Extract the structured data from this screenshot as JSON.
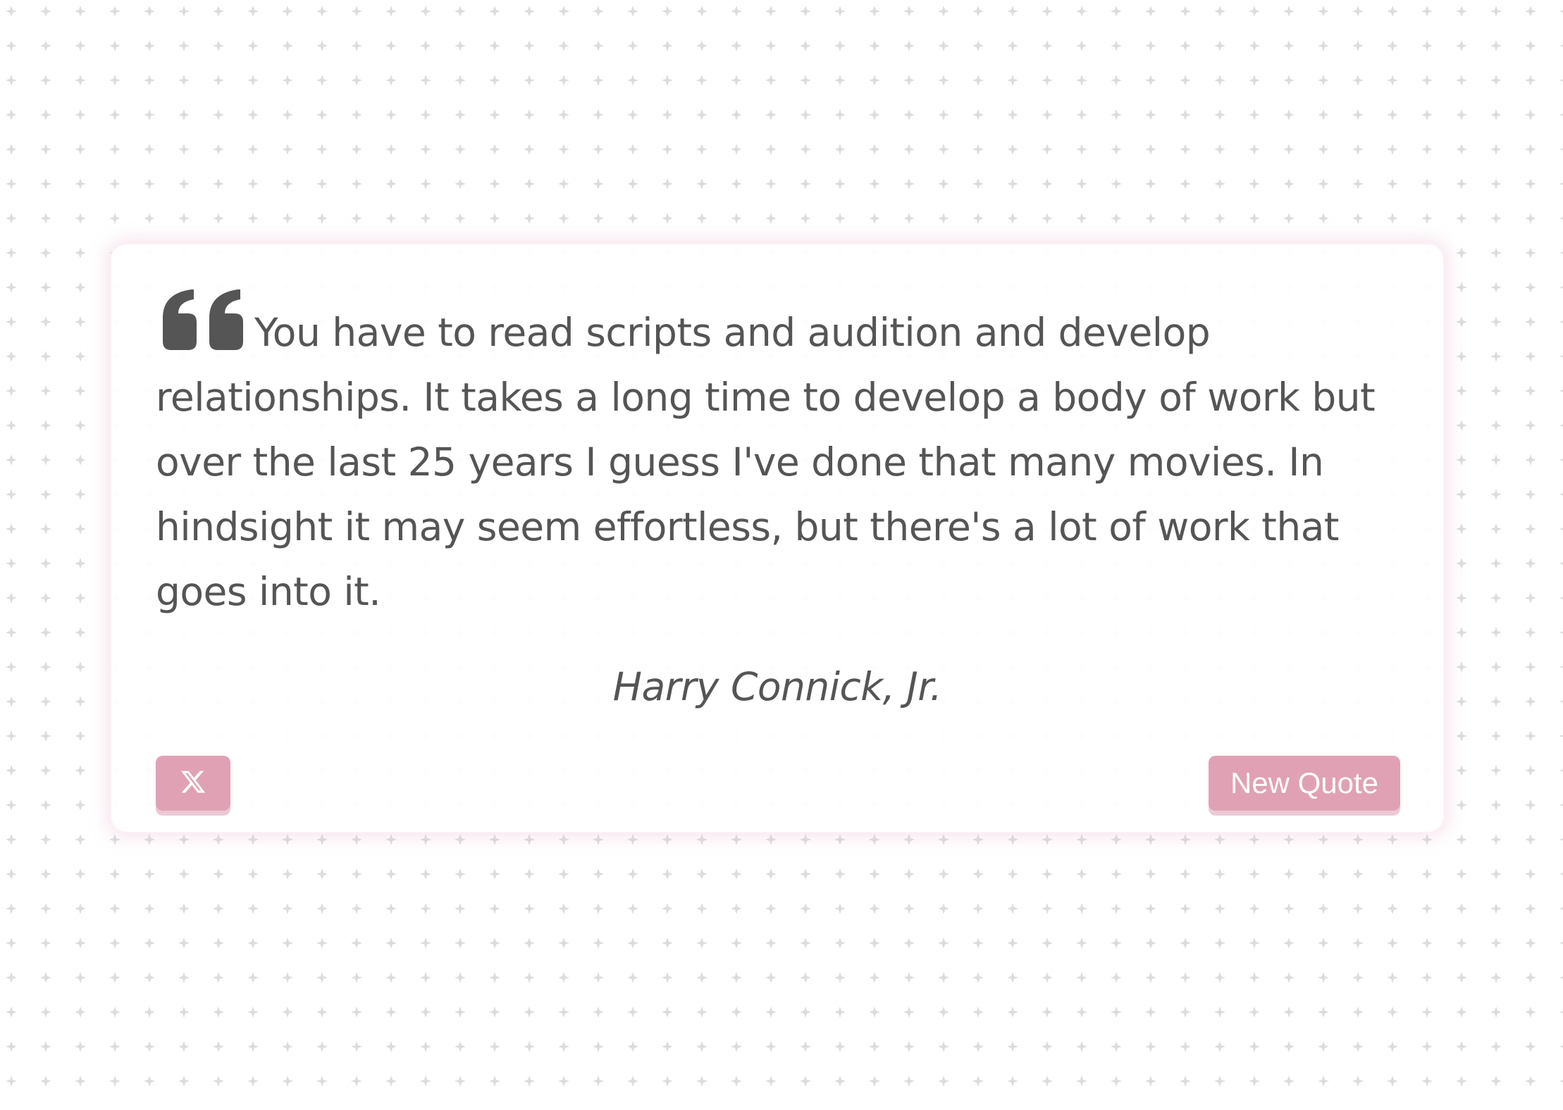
{
  "quote": {
    "text": "You have to read scripts and audition and develop relationships. It takes a long time to develop a body of work but over the last 25 years I guess I've done that many movies. In hindsight it may seem effortless, but there's a lot of work that goes into it.",
    "author": "Harry Connick, Jr.",
    "icon": "quote-left-icon"
  },
  "actions": {
    "share_icon": "x-logo-icon",
    "new_quote_label": "New Quote"
  },
  "colors": {
    "accent": "#e0a1b4",
    "text": "#555555",
    "pattern": "#d8d8d8"
  }
}
